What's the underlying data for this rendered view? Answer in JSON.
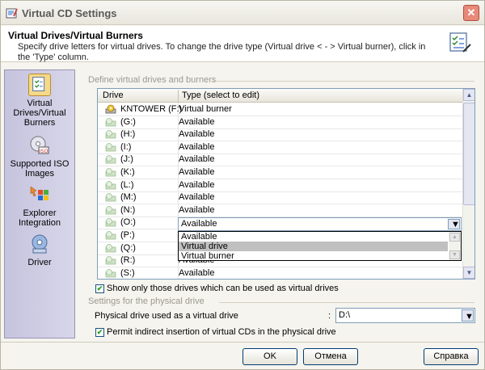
{
  "window": {
    "title": "Virtual CD Settings"
  },
  "header": {
    "title": "Virtual Drives/Virtual Burners",
    "description": "Specify drive letters for virtual drives. To change the drive type (Virtual drive < - > Virtual burner), click in the 'Type' column."
  },
  "sidebar": {
    "items": [
      {
        "label": "Virtual Drives/Virtual Burners",
        "icon": "virtual-drives-icon",
        "selected": true
      },
      {
        "label": "Supported ISO Images",
        "icon": "iso-images-icon",
        "selected": false
      },
      {
        "label": "Explorer Integration",
        "icon": "explorer-integration-icon",
        "selected": false
      },
      {
        "label": "Driver",
        "icon": "driver-icon",
        "selected": false
      }
    ]
  },
  "drives_group": {
    "label": "Define virtual drives and burners",
    "columns": [
      "Drive",
      "Type (select to edit)"
    ],
    "rows": [
      {
        "drive": "KNTOWER (F:)",
        "type": "Virtual burner",
        "icon": "burner-icon"
      },
      {
        "drive": "(G:)",
        "type": "Available",
        "icon": "disk-icon"
      },
      {
        "drive": "(H:)",
        "type": "Available",
        "icon": "disk-icon"
      },
      {
        "drive": "(I:)",
        "type": "Available",
        "icon": "disk-icon"
      },
      {
        "drive": "(J:)",
        "type": "Available",
        "icon": "disk-icon"
      },
      {
        "drive": "(K:)",
        "type": "Available",
        "icon": "disk-icon"
      },
      {
        "drive": "(L:)",
        "type": "Available",
        "icon": "disk-icon"
      },
      {
        "drive": "(M:)",
        "type": "Available",
        "icon": "disk-icon"
      },
      {
        "drive": "(N:)",
        "type": "Available",
        "icon": "disk-icon"
      },
      {
        "drive": "(O:)",
        "type": "Available",
        "icon": "disk-icon"
      },
      {
        "drive": "(P:)",
        "type": "Available",
        "icon": "disk-icon"
      },
      {
        "drive": "(Q:)",
        "type": "Available",
        "icon": "disk-icon"
      },
      {
        "drive": "(R:)",
        "type": "Available",
        "icon": "disk-icon"
      },
      {
        "drive": "(S:)",
        "type": "Available",
        "icon": "disk-icon"
      }
    ],
    "editor": {
      "value": "Available",
      "options": [
        "Available",
        "Virtual drive",
        "Virtual burner"
      ],
      "highlighted": "Virtual drive"
    },
    "checkbox_label": "Show only those drives which can be used as virtual drives",
    "checkbox_checked": true
  },
  "physical_group": {
    "label": "Settings for the physical drive",
    "field_label": "Physical drive used as a virtual drive",
    "colon": ":",
    "value": "D:\\",
    "checkbox_label": "Permit indirect insertion of virtual CDs in the physical drive",
    "checkbox_checked": true
  },
  "buttons": {
    "ok": "OK",
    "cancel": "Отмена",
    "help": "Справка"
  }
}
